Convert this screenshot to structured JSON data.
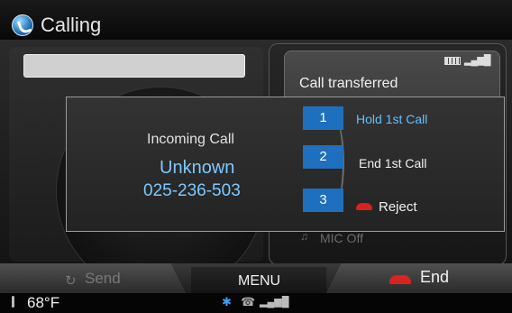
{
  "header": {
    "title": "Calling",
    "app_icon": "phone-app-icon"
  },
  "info_panel": {
    "status_text": "Call transferred",
    "battery_icon": "battery-icon",
    "signal_icon": "signal-icon"
  },
  "mic": {
    "label": "MIC Off",
    "icon": "mic-off-icon"
  },
  "popup": {
    "title": "Incoming Call",
    "caller_name": "Unknown",
    "caller_number": "025-236-503",
    "options": [
      {
        "number": "1",
        "label": "Hold 1st Call"
      },
      {
        "number": "2",
        "label": "End 1st Call"
      },
      {
        "number": "3",
        "label": "Reject"
      }
    ]
  },
  "softkeys": {
    "send": "Send",
    "menu": "MENU",
    "end": "End"
  },
  "status_bar": {
    "temperature": "68°F",
    "bluetooth_icon": "bluetooth-icon",
    "phone_icon": "phone-icon",
    "signal_icon": "signal-icon"
  },
  "colors": {
    "accent": "#1f6fbf",
    "caller_text": "#7cc8ff",
    "end_red": "#d8231f"
  },
  "glyphs": {
    "bluetooth": "✱",
    "signal": "▂▄▆█",
    "send": "↻",
    "mic": "♫",
    "phone": "☎"
  }
}
